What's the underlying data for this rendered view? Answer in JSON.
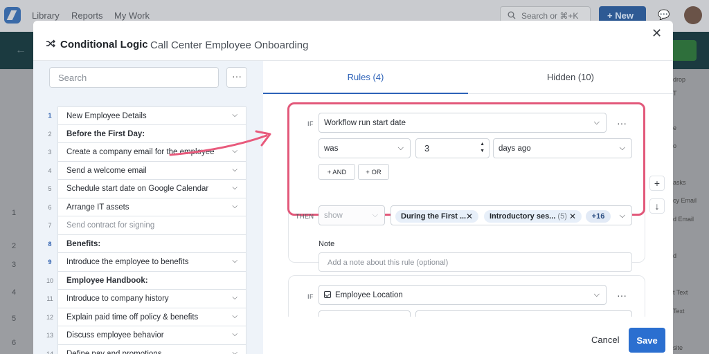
{
  "background_app": {
    "nav": [
      "Library",
      "Reports",
      "My Work"
    ],
    "search_placeholder": "Search or ⌘+K",
    "new_button": "New",
    "row_numbers": [
      "1",
      "2",
      "3",
      "4",
      "5",
      "6"
    ],
    "right_snippets": [
      "drop",
      "T",
      "e",
      "o",
      "asks",
      "cy Email",
      "d Email",
      "d",
      "t Text",
      "Text",
      "site"
    ]
  },
  "modal": {
    "title": "Conditional Logic",
    "subtitle": "Call Center Employee Onboarding",
    "search_placeholder": "Search",
    "more_label": "···",
    "steps": [
      {
        "num": "1",
        "label": "New Employee Details",
        "type": "item",
        "num_blue": true
      },
      {
        "num": "2",
        "label": "Before the First Day:",
        "type": "heading",
        "num_blue": false
      },
      {
        "num": "3",
        "label": "Create a company email for the employee",
        "type": "item",
        "num_blue": false
      },
      {
        "num": "4",
        "label": "Send a welcome email",
        "type": "item",
        "num_blue": false
      },
      {
        "num": "5",
        "label": "Schedule start date on Google Calendar",
        "type": "item",
        "num_blue": false
      },
      {
        "num": "6",
        "label": "Arrange IT assets",
        "type": "item",
        "num_blue": false
      },
      {
        "num": "7",
        "label": "Send contract for signing",
        "type": "muted",
        "num_blue": false
      },
      {
        "num": "8",
        "label": "Benefits:",
        "type": "heading",
        "num_blue": true
      },
      {
        "num": "9",
        "label": "Introduce the employee to benefits",
        "type": "item",
        "num_blue": true
      },
      {
        "num": "10",
        "label": "Employee Handbook:",
        "type": "heading",
        "num_blue": false
      },
      {
        "num": "11",
        "label": "Introduce to company history",
        "type": "item",
        "num_blue": false
      },
      {
        "num": "12",
        "label": "Explain paid time off policy & benefits",
        "type": "item",
        "num_blue": false
      },
      {
        "num": "13",
        "label": "Discuss employee behavior",
        "type": "item",
        "num_blue": false
      },
      {
        "num": "14",
        "label": "Define pay and promotions",
        "type": "item",
        "num_blue": false
      }
    ],
    "tabs": [
      {
        "label": "Rules (4)",
        "active": true
      },
      {
        "label": "Hidden (10)",
        "active": false
      }
    ],
    "rule1": {
      "if_label": "IF",
      "field": "Workflow run start date",
      "operator": "was",
      "value": "3",
      "unit": "days ago",
      "and_label": "+ AND",
      "or_label": "+ OR",
      "then_label": "THEN",
      "action": "show",
      "chips": [
        {
          "label": "During the First ...",
          "count": ""
        },
        {
          "label": "Introductory ses...",
          "count": "(5)"
        }
      ],
      "more_count": "+16",
      "note_label": "Note",
      "note_placeholder": "Add a note about this rule (optional)"
    },
    "rule2": {
      "if_label": "IF",
      "field": "Employee Location"
    },
    "side_buttons": [
      "+",
      "↓"
    ],
    "cancel": "Cancel",
    "save": "Save",
    "colors": {
      "highlight": "#e2587a",
      "accent": "#2b6fd0"
    }
  }
}
